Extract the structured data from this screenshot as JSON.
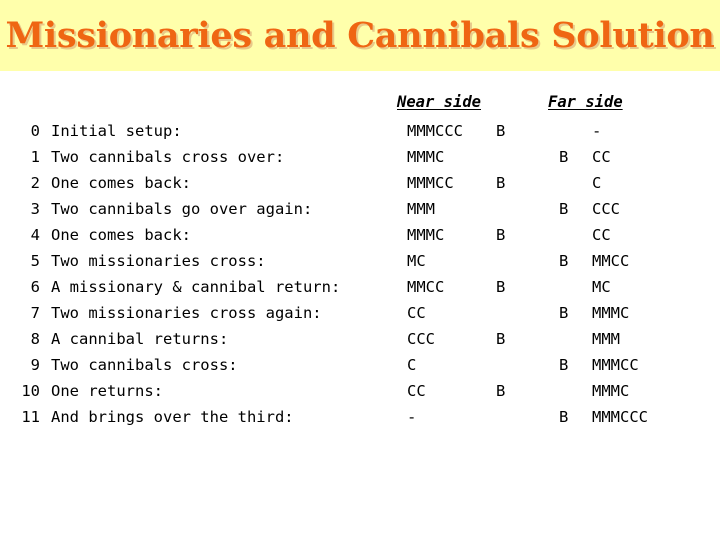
{
  "title": "Missionaries and Cannibals Solution",
  "theme": {
    "banner_bg": "#ffffab",
    "title_color": "#ef6613",
    "title_shadow_color": "#e8c98a",
    "page_bg": "#ffffff",
    "text_color": "#000000"
  },
  "table": {
    "headers": {
      "near_side": "Near side",
      "far_side": "Far side"
    },
    "boat_symbol": "B",
    "empty_symbol": "-",
    "rows": [
      {
        "step": "0",
        "description": "Initial setup:",
        "near": "MMMCCC",
        "boat_near": "B",
        "boat_far": "",
        "far": "-"
      },
      {
        "step": "1",
        "description": "Two cannibals cross over:",
        "near": "MMMC",
        "boat_near": "",
        "boat_far": "B",
        "far": "CC"
      },
      {
        "step": "2",
        "description": "One comes back:",
        "near": "MMMCC",
        "boat_near": "B",
        "boat_far": "",
        "far": "C"
      },
      {
        "step": "3",
        "description": "Two cannibals go over again:",
        "near": "MMM",
        "boat_near": "",
        "boat_far": "B",
        "far": "CCC"
      },
      {
        "step": "4",
        "description": "One comes back:",
        "near": "MMMC",
        "boat_near": "B",
        "boat_far": "",
        "far": "CC"
      },
      {
        "step": "5",
        "description": "Two missionaries cross:",
        "near": "MC",
        "boat_near": "",
        "boat_far": "B",
        "far": "MMCC"
      },
      {
        "step": "6",
        "description": "A missionary & cannibal return:",
        "near": "MMCC",
        "boat_near": "B",
        "boat_far": "",
        "far": "MC"
      },
      {
        "step": "7",
        "description": "Two missionaries cross again:",
        "near": "CC",
        "boat_near": "",
        "boat_far": "B",
        "far": "MMMC"
      },
      {
        "step": "8",
        "description": "A cannibal returns:",
        "near": "CCC",
        "boat_near": "B",
        "boat_far": "",
        "far": "MMM"
      },
      {
        "step": "9",
        "description": "Two cannibals cross:",
        "near": "C",
        "boat_near": "",
        "boat_far": "B",
        "far": "MMMCC"
      },
      {
        "step": "10",
        "description": "One returns:",
        "near": "CC",
        "boat_near": "B",
        "boat_far": "",
        "far": "MMMC"
      },
      {
        "step": "11",
        "description": "And brings over the third:",
        "near": "-",
        "boat_near": "",
        "boat_far": "B",
        "far": "MMMCCC"
      }
    ]
  }
}
